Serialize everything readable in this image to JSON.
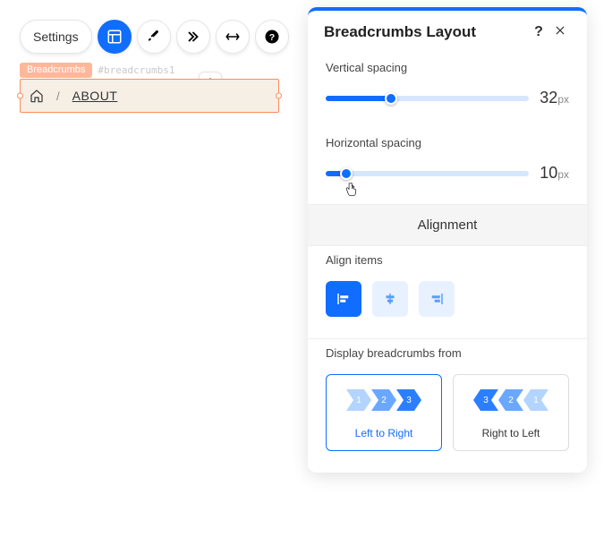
{
  "toolbar": {
    "settings": "Settings"
  },
  "element": {
    "tag": "Breadcrumbs",
    "id": "#breadcrumbs1"
  },
  "breadcrumb": {
    "separator": "/",
    "current": "ABOUT"
  },
  "panel": {
    "title": "Breadcrumbs Layout",
    "vertical_spacing_label": "Vertical spacing",
    "vertical_spacing_value": "32",
    "horizontal_spacing_label": "Horizontal spacing",
    "horizontal_spacing_value": "10",
    "unit": "px",
    "alignment_header": "Alignment",
    "align_items_label": "Align items",
    "display_from_label": "Display breadcrumbs from",
    "ltr_label": "Left to Right",
    "rtl_label": "Right to Left"
  }
}
